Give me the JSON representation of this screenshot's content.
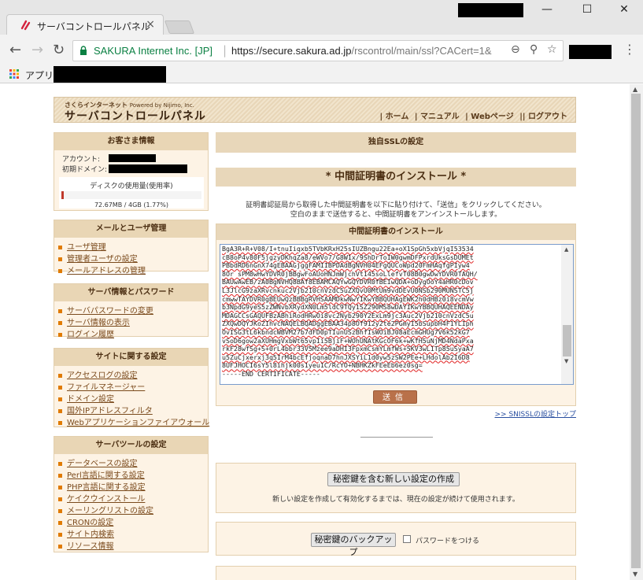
{
  "browser": {
    "tab_title": "サーバコントロールパネル",
    "tab_close": "×",
    "window_controls": [
      "—",
      "☐",
      "✕"
    ],
    "org_name": "SAKURA Internet Inc. [JP]",
    "url_separator": "|",
    "url_host": "https://secure.sakura.ad.jp",
    "url_path": "/rscontrol/main/ssl?CACert=1&",
    "bookmarks_apps_label": "アプリ",
    "menu_dots": "⋮"
  },
  "header": {
    "logo_small": "さくらインターネット",
    "logo_powered": "Powered by Nijimo, Inc.",
    "logo_main": "サーバコントロールパネル",
    "nav": [
      "| ホーム",
      "| マニュアル",
      "| Webページ",
      "|| ログアウト"
    ]
  },
  "sidebar": {
    "customer": {
      "heading": "お客さま情報",
      "account_label": "アカウント:",
      "domain_label": "初期ドメイン:",
      "disk_heading": "ディスクの使用量(使用率)",
      "disk_usage": "72.67MB / 4GB (1.77%)",
      "disk_fraction": 0.0177
    },
    "mail": {
      "heading": "メールとユーザ管理",
      "items": [
        "ユーザ管理",
        "管理者ユーザの設定",
        "メールアドレスの管理"
      ]
    },
    "server_info": {
      "heading": "サーバ情報とパスワード",
      "items": [
        "サーバパスワードの変更",
        "サーバ情報の表示",
        "ログイン履歴"
      ]
    },
    "site": {
      "heading": "サイトに関する設定",
      "items": [
        "アクセスログの設定",
        "ファイルマネージャー",
        "ドメイン設定",
        "国外IPアドレスフィルタ",
        "Webアプリケーションファイアウォール"
      ]
    },
    "tools": {
      "heading": "サーバツールの設定",
      "items": [
        "データベースの設定",
        "Perl言語に関する設定",
        "PHP言語に関する設定",
        "ケイクウインストール",
        "メーリングリストの設定",
        "CRONの設定",
        "サイト内検索",
        "リソース情報"
      ]
    }
  },
  "main": {
    "heading": "独自SSLの設定",
    "section_title": "* 中間証明書のインストール *",
    "description_line1": "証明書認証局から取得した中間証明書を以下に貼り付けて、「送信」をクリックしてください。",
    "description_line2": "空白のままで送信すると、中間証明書をアンインストールします。",
    "form_heading": "中間証明書のインストール",
    "certificate_lines": [
      "BgA3R+R+V08/I+tnuIiqxb5TVbKRxH25sIUZBngu22Ea+oX1SpGh5xbVjqI53534",
      "cB8oP4v80F5jgzyDKhqZa8/eWVo7/G8W1x/9ShDrToIW0gwmDFPxrdUksGsDUMEt",
      "PBbdRD6nGnX74gEBAAGjggFAMIIBPDAdBgNVH04EFgQUCoWpd20FmHAqfgPIyw4",
      "8Or sPM8wHwYDVR0jBBgwFoAUoHNJmWjchVt145soLlefvT08B0gwDwYDVR0TAQH/",
      "BAUwAwEB/zA0BgNVHQ8BAf8EBAMCAQYwGQYDVR0fBEIwQDA+oDygOoY4aHR0cDov",
      "L3JlcG9zaXRvcnkuc2Vjb210cnVzdC5uZXQvU0MtUm9vdDEvU0NSb290MUNSTC5j",
      "cmwwTAYDVR0gBEUwQzBBBgRVHSAAMDkwNwYIKwYBBQUHAgEWK2h0dHBz0i8vcmVw",
      "b3NpdG9yeS5zZWNvbXRydXN0Lm5ldC9TQy1SZ290MS8wDAYIKwYBBQUHAQEENDAy",
      "MDAGCCsGAQUFBzABhiRodHRwOi8vc2Nyb290Y2ExLm9jc3Auc2Vjb210cnVzdC5u",
      "ZXQwDQYJKoZIhvcNAQELBQADggEBAA34p8Of912y2te2PGmyI5bSupbH4F1YLIph",
      "OvISG3tL6kbndcWBVM27b7dFD0pTIunUSzBhfIsWOiBJ08aEcmGHUg7V6k52kG7",
      "vSoD6gow2aXUHmgVxbWt65vpIi5BjiF+WOhUNAtKGcOF6k+wKfH5uNjMD4NdaPxa",
      "rkF28wfSg+S+0rL4bbr33V5Mzee9aDHI3FpxmCsmYLmfWs+5KV3wL1Tp85uSyaA7",
      "u5ZuCjxerxj3q5IrM4bcEfjoqnaD7hnJXSYiL1d0yw5zSW2PEe+LHdolAb2I6D8",
      "8UFJHOCI6sY5l8ihjk00s1yeu1C/RcYO+NBHKZkFEeEb6ez0sg=",
      "-----END CERTIFICATE-----"
    ],
    "submit_label": "送信",
    "sni_link": ">> SNISSLの設定トップ",
    "create_key_button": "秘密鍵を含む新しい設定の作成",
    "create_key_note": "新しい設定を作成して有効化するまでは、現在の設定が続けて使用されます。",
    "backup_button": "秘密鍵のバックアップ",
    "backup_password_label": "パスワードをつける"
  }
}
